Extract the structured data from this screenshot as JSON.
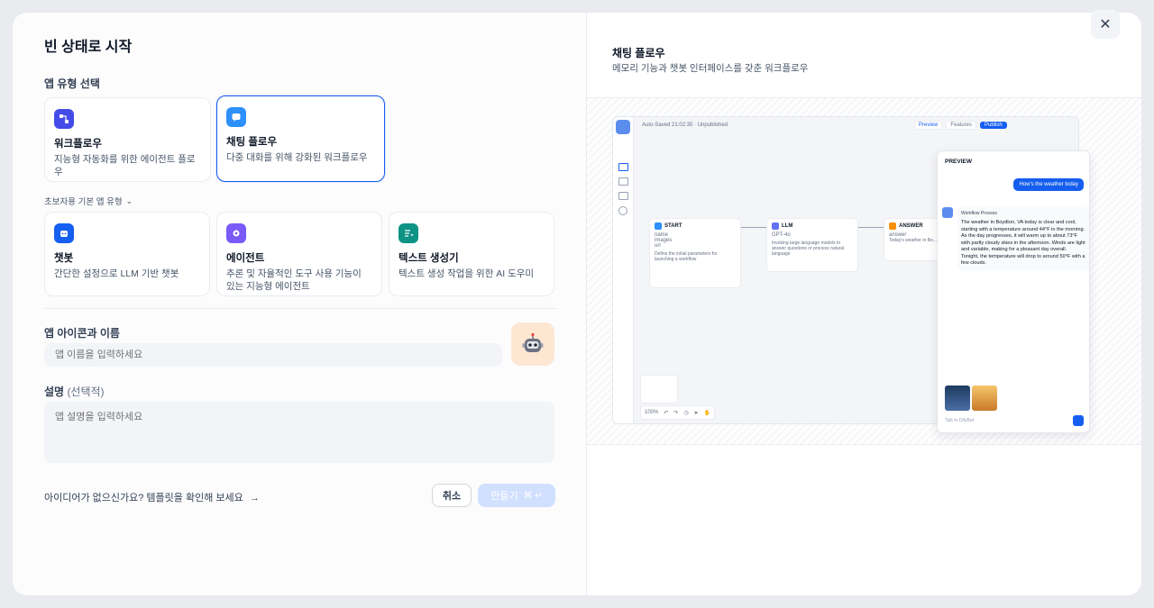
{
  "title": "빈 상태로 시작",
  "app_type_label": "앱 유형 선택",
  "cards_main": [
    {
      "title": "워크플로우",
      "desc": "지능형 자동화를 위한 에이전트 플로우",
      "icon": "workflow-icon",
      "color": "#444ce7"
    },
    {
      "title": "채팅 플로우",
      "desc": "다중 대화를 위해 강화된 워크플로우",
      "icon": "chatflow-icon",
      "color": "#2e90fa"
    }
  ],
  "beginner_label": "초보자용 기본 앱 유형",
  "cards_basic": [
    {
      "title": "챗봇",
      "desc": "간단한 설정으로 LLM 기반 챗봇",
      "icon": "chatbot-icon",
      "color": "#155eef"
    },
    {
      "title": "에이전트",
      "desc": "추론 및 자율적인 도구 사용 기능이 있는 지능형 에이전트",
      "icon": "agent-icon",
      "color": "#7a5af8"
    },
    {
      "title": "텍스트 생성기",
      "desc": "텍스트 생성 작업을 위한 AI 도우미",
      "icon": "text-generator-icon",
      "color": "#0e9384"
    }
  ],
  "name_section": {
    "label": "앱 아이콘과 이름",
    "placeholder": "앱 이름을 입력하세요"
  },
  "desc_section": {
    "label": "설명",
    "optional": "(선택적)",
    "placeholder": "앱 설명을 입력하세요"
  },
  "footer_link": "아이디어가 없으신가요? 템플릿을 확인해 보세요",
  "buttons": {
    "cancel": "취소",
    "create": "만들기",
    "create_shortcut": "⌘ ↵"
  },
  "preview": {
    "title": "채팅 플로우",
    "subtitle": "메모리 기능과 챗봇 인터페이스를 갖춘 워크플로우",
    "canvas_header": "Auto-Saved 21:02:35 · Unpublished",
    "toolbar": {
      "preview": "Preview",
      "features": "Features",
      "publish": "Publish"
    },
    "nodes": {
      "start": {
        "title": "START",
        "vars": [
          "name",
          "images",
          "url"
        ],
        "desc": "Define the initial parameters for launching a workflow"
      },
      "llm": {
        "title": "LLM",
        "model": "GPT-4o",
        "desc": "Invoking large language models to answer questions or process natural language"
      },
      "answer": {
        "title": "ANSWER",
        "line1": "answer",
        "line2": "Today's weather in Bo..."
      }
    },
    "zoom": "100%",
    "chat": {
      "header": "PREVIEW",
      "user_msg": "How's the weather today",
      "process": "Workflow Process",
      "reply": "The weather in Boydton, VA today is clear and cool, starting with a temperature around 44°F in the morning. As the day progresses, it will warm up to about 73°F with partly cloudy skies in the afternoon. Winds are light and variable, making for a pleasant day overall. Tonight, the temperature will drop to around 50°F with a few clouds.",
      "input_placeholder": "Talk to DifyBot"
    }
  }
}
